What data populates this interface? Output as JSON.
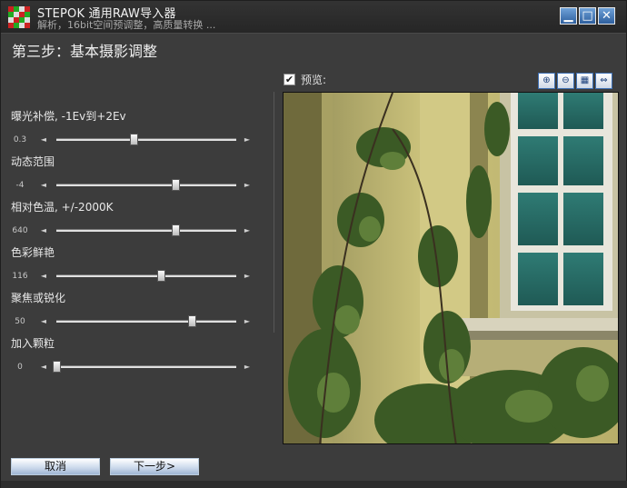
{
  "window": {
    "title": "STEPOK 通用RAW导入器",
    "subtitle": "解析，16bit空间预调整，高质量转换 ...",
    "minimize_glyph": "▁",
    "maximize_glyph": "□",
    "close_glyph": "✕"
  },
  "step_title": "第三步：基本摄影调整",
  "sliders": [
    {
      "label": "曝光补偿, -1Ev到+2Ev",
      "value": "0.3",
      "position": 0.43
    },
    {
      "label": "动态范围",
      "value": "-4",
      "position": 0.66
    },
    {
      "label": "相对色温, +/-2000K",
      "value": "640",
      "position": 0.66
    },
    {
      "label": "色彩鲜艳",
      "value": "116",
      "position": 0.58
    },
    {
      "label": "聚焦或锐化",
      "value": "50",
      "position": 0.75
    },
    {
      "label": "加入颗粒",
      "value": "0",
      "position": 0.0
    }
  ],
  "arrows": {
    "left": "◄",
    "right": "►"
  },
  "preview": {
    "label": "预览:",
    "checked": true,
    "check_glyph": "✔",
    "tools": [
      {
        "name": "zoom-in-icon",
        "glyph": "⊕"
      },
      {
        "name": "zoom-out-icon",
        "glyph": "⊖"
      },
      {
        "name": "actual-size-icon",
        "glyph": "▦"
      },
      {
        "name": "fit-window-icon",
        "glyph": "⇔"
      }
    ]
  },
  "buttons": {
    "cancel": "取消",
    "next": "下一步>"
  },
  "colors": {
    "accent": "#2e5f9e",
    "background": "#3c3c3c"
  }
}
